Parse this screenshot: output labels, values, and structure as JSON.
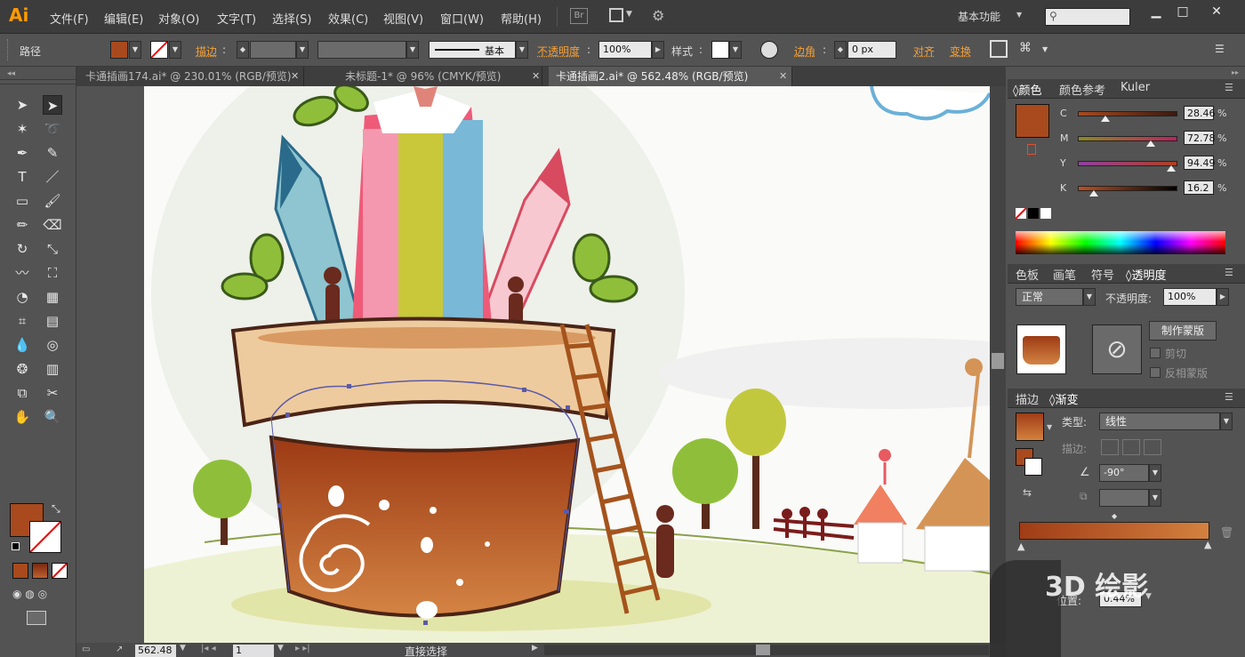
{
  "app": {
    "logo": "Ai",
    "menus": [
      "文件(F)",
      "编辑(E)",
      "对象(O)",
      "文字(T)",
      "选择(S)",
      "效果(C)",
      "视图(V)",
      "窗口(W)",
      "帮助(H)"
    ],
    "br_badge": "Br",
    "workspace": "基本功能",
    "search_placeholder": ""
  },
  "control_bar": {
    "object_type": "路径",
    "fill_color": "#a84a1e",
    "stroke_label": "描边",
    "stroke_style_label": "基本",
    "opacity_label": "不透明度",
    "opacity_value": "100%",
    "style_label": "样式",
    "corner_label": "边角",
    "corner_value": "0 px",
    "align_label": "对齐",
    "transform_label": "变换"
  },
  "tabs": [
    {
      "label": "卡通插画174.ai* @ 230.01% (RGB/预览)",
      "active": false
    },
    {
      "label": "未标题-1* @ 96% (CMYK/预览)",
      "active": false
    },
    {
      "label": "卡通插画2.ai* @ 562.48% (RGB/预览)",
      "active": true
    }
  ],
  "tools": [
    [
      "selection-icon",
      "direct-selection-icon"
    ],
    [
      "magic-wand-icon",
      "lasso-icon"
    ],
    [
      "pen-icon",
      "curvature-icon"
    ],
    [
      "type-icon",
      "line-icon"
    ],
    [
      "rectangle-icon",
      "paintbrush-icon"
    ],
    [
      "pencil-icon",
      "eraser-icon"
    ],
    [
      "rotate-icon",
      "scale-icon"
    ],
    [
      "warp-icon",
      "free-transform-icon"
    ],
    [
      "shape-builder-icon",
      "graph-icon"
    ],
    [
      "mesh-icon",
      "gradient-icon"
    ],
    [
      "eyedropper-icon",
      "blend-icon"
    ],
    [
      "symbol-sprayer-icon",
      "column-graph-icon"
    ],
    [
      "artboard-icon",
      "slice-icon"
    ],
    [
      "hand-icon",
      "zoom-icon"
    ]
  ],
  "status": {
    "zoom": "562.48",
    "page": "1",
    "tool_name": "直接选择"
  },
  "color_panel": {
    "tabs": [
      "颜色",
      "颜色参考",
      "Kuler"
    ],
    "swatch": "#a84a1e",
    "channels": [
      {
        "label": "C",
        "value": "28.46",
        "pos": 0.28
      },
      {
        "label": "M",
        "value": "72.78",
        "pos": 0.73
      },
      {
        "label": "Y",
        "value": "94.49",
        "pos": 0.94
      },
      {
        "label": "K",
        "value": "16.2",
        "pos": 0.16
      }
    ]
  },
  "transparency_panel": {
    "tabs": [
      "色板",
      "画笔",
      "符号",
      "透明度"
    ],
    "blend_mode": "正常",
    "opacity_label": "不透明度:",
    "opacity_value": "100%",
    "make_mask": "制作蒙版",
    "clip": "剪切",
    "invert": "反相蒙版"
  },
  "gradient_panel": {
    "tabs": [
      "描边",
      "渐变"
    ],
    "type_label": "类型:",
    "type_value": "线性",
    "stroke_label": "描边:",
    "angle_value": "-90°",
    "location_label": "位置:",
    "location_value": "0.44%",
    "start_color": "#a03c16",
    "end_color": "#d4813f"
  },
  "watermark": "3D 绘影"
}
